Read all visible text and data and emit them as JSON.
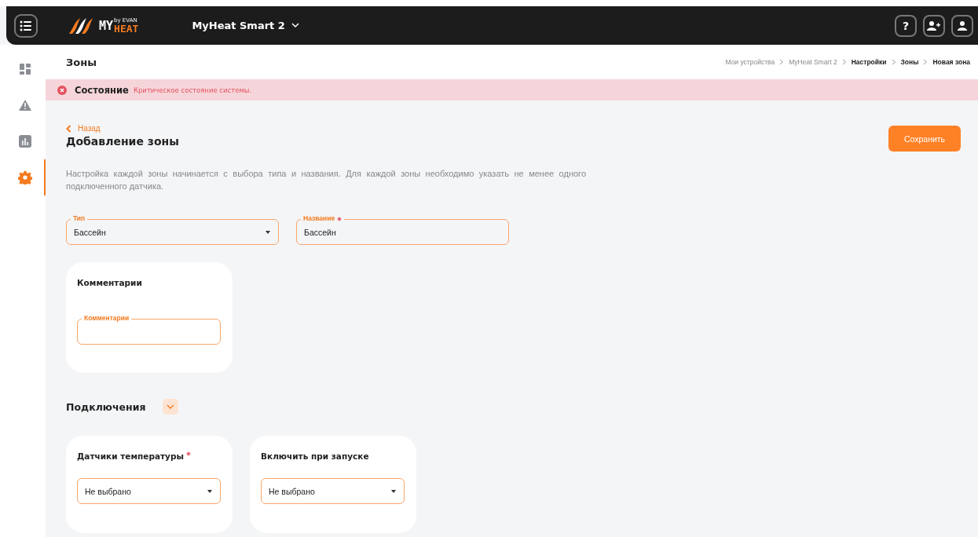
{
  "topbar": {
    "device": "MyHeat Smart 2",
    "logo": {
      "main": "MY",
      "sub": "HEAT",
      "by": "by EVAN"
    },
    "icons": [
      {
        "kind": "help",
        "label": "?"
      },
      {
        "kind": "add-user"
      },
      {
        "kind": "user"
      }
    ]
  },
  "sidebar": {
    "items": [
      {
        "kind": "dashboard",
        "selected": false
      },
      {
        "kind": "warning",
        "selected": false
      },
      {
        "kind": "chart",
        "selected": false
      },
      {
        "kind": "settings",
        "selected": true
      }
    ]
  },
  "page": {
    "title": "Зоны",
    "breadcrumbs": [
      {
        "label": "Мои устройства",
        "current": false
      },
      {
        "label": "MyHeat Smart 2",
        "current": false
      },
      {
        "label": "Настройки",
        "current": true
      },
      {
        "label": "Зоны",
        "current": true
      },
      {
        "label": "Новая зона",
        "current": true
      }
    ]
  },
  "status": {
    "label": "Состояние",
    "message": "Критическое состояние системы."
  },
  "form": {
    "back": "Назад",
    "heading": "Добавление зоны",
    "save": "Сохранить",
    "description": "Настройка каждой зоны начинается с выбора типа и названия. Для каждой зоны необходимо указать не менее одного подключенного датчика.",
    "fields": [
      {
        "kind": "select",
        "label": "Тип",
        "required": false,
        "value": "Бассейн"
      },
      {
        "kind": "text",
        "label": "Название",
        "required": true,
        "value": "Бассейн"
      }
    ],
    "comments": {
      "title": "Комментарии",
      "label": "Комментарии"
    },
    "connections": {
      "title": "Подключения",
      "expanded": true,
      "cards": [
        {
          "title": "Датчики температуры",
          "required": true,
          "value": "Не выбрано"
        },
        {
          "title": "Включить при запуске",
          "required": false,
          "value": "Не выбрано"
        }
      ]
    }
  }
}
